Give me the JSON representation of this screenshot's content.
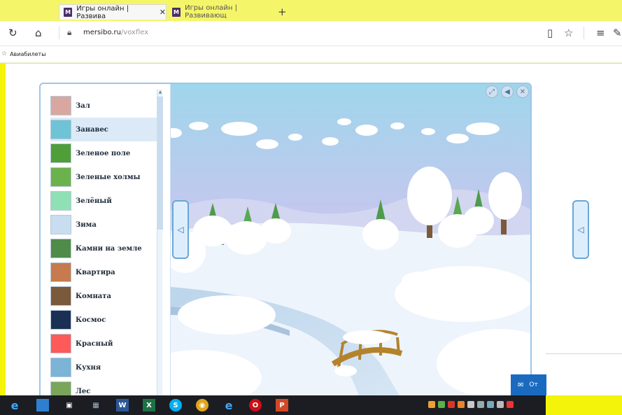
{
  "browser": {
    "tabs": [
      {
        "title": "Игры онлайн | Развива",
        "favicon": "M",
        "active": true
      },
      {
        "title": "Игры онлайн | Развивающ",
        "favicon": "M",
        "active": false
      }
    ],
    "close_glyph": "✕",
    "new_tab_glyph": "+",
    "url": {
      "domain": "mersibo.ru",
      "path": "/voxflex"
    },
    "favorites_bar": {
      "item": "Авиабилеты"
    }
  },
  "game": {
    "list": [
      {
        "label": "Зал",
        "thumb_color": "#d9a7a0"
      },
      {
        "label": "Занавес",
        "thumb_color": "#6ec3d6",
        "selected": true
      },
      {
        "label": "Зеленое поле",
        "thumb_color": "#4f9e3a"
      },
      {
        "label": "Зеленые холмы",
        "thumb_color": "#6cb24c"
      },
      {
        "label": "Зелёный",
        "thumb_color": "#8fe0b4"
      },
      {
        "label": "Зима",
        "thumb_color": "#c8ddf0"
      },
      {
        "label": "Камни на земле",
        "thumb_color": "#4f8c4a"
      },
      {
        "label": "Квартира",
        "thumb_color": "#c67a4e"
      },
      {
        "label": "Комната",
        "thumb_color": "#7a5a3a"
      },
      {
        "label": "Космос",
        "thumb_color": "#1b2f55"
      },
      {
        "label": "Красный",
        "thumb_color": "#ff5a5a"
      },
      {
        "label": "Кухня",
        "thumb_color": "#7bb4d6"
      },
      {
        "label": "Лес",
        "thumb_color": "#7aa65a"
      }
    ],
    "controls": [
      "fullscreen-icon",
      "sound-icon",
      "close-icon"
    ],
    "collapse_arrow": "◁"
  },
  "chat": {
    "label": "От"
  },
  "colors": {
    "screen_border": "#f4f40a",
    "accent": "#1a6bc0",
    "panel_border": "#9ec5ea"
  }
}
